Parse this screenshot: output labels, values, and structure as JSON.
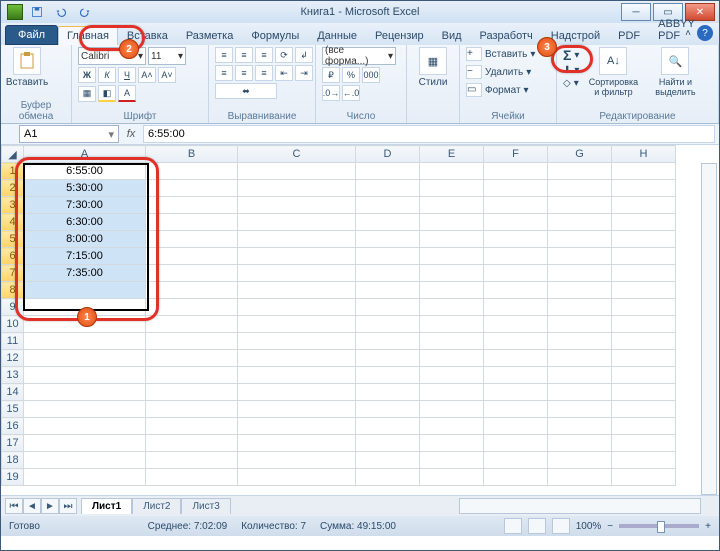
{
  "title": "Книга1 - Microsoft Excel",
  "tabs": {
    "file": "Файл",
    "items": [
      "Главная",
      "Вставка",
      "Разметка",
      "Формулы",
      "Данные",
      "Рецензир",
      "Вид",
      "Разработч",
      "Надстрой",
      "PDF",
      "ABBYY PDF"
    ],
    "active": 0
  },
  "ribbon": {
    "clipboard": {
      "label": "Буфер обмена",
      "paste": "Вставить"
    },
    "font": {
      "label": "Шрифт",
      "name": "Calibri",
      "size": "11"
    },
    "align": {
      "label": "Выравнивание"
    },
    "number": {
      "label": "Число",
      "format": "(все форма...)",
      "percent": "%",
      "thousands": "000"
    },
    "styles": {
      "label": "Стили",
      "btn": "Стили"
    },
    "cells": {
      "label": "Ячейки",
      "insert": "Вставить",
      "delete": "Удалить",
      "format": "Формат"
    },
    "editing": {
      "label": "Редактирование",
      "sort": "Сортировка и фильтр",
      "find": "Найти и выделить",
      "autosum": "Σ"
    }
  },
  "namebox": "A1",
  "formula": "6:55:00",
  "columns": [
    "A",
    "B",
    "C",
    "D",
    "E",
    "F",
    "G",
    "H"
  ],
  "rows_visible": 19,
  "data": {
    "A": [
      "6:55:00",
      "5:30:00",
      "7:30:00",
      "6:30:00",
      "8:00:00",
      "7:15:00",
      "7:35:00"
    ]
  },
  "selection": {
    "range": "A1:A8",
    "active": "A1"
  },
  "sheets": {
    "items": [
      "Лист1",
      "Лист2",
      "Лист3"
    ],
    "active": 0
  },
  "status": {
    "mode": "Готово",
    "avg_label": "Среднее:",
    "avg": "7:02:09",
    "count_label": "Количество:",
    "count": "7",
    "sum_label": "Сумма:",
    "sum": "49:15:00",
    "zoom": "100%"
  },
  "callouts": {
    "1": "1",
    "2": "2",
    "3": "3"
  },
  "chart_data": null
}
